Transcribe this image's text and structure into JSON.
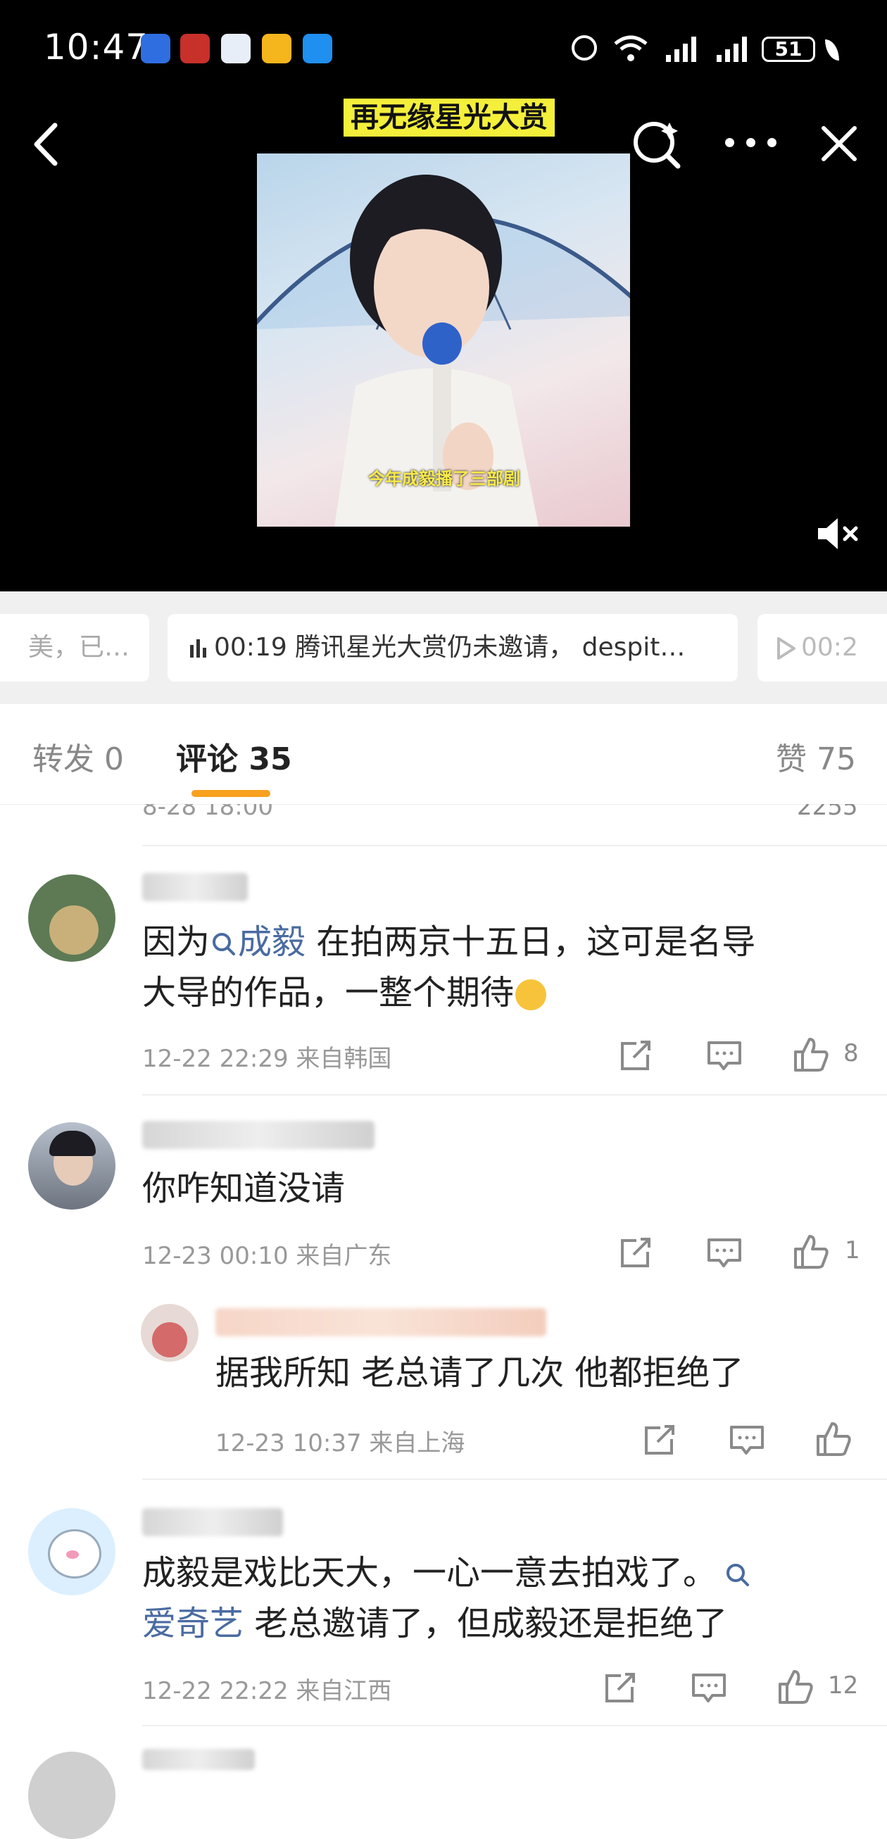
{
  "status_bar": {
    "time": "10:47",
    "battery": "51"
  },
  "video": {
    "title": "再无缘星光大赏",
    "subtitle": "今年成毅播了三部剧"
  },
  "audio_chips": {
    "left": "美，已…",
    "middle_time": "00:19",
    "middle_text": "腾讯星光大赏仍未邀请， despit…",
    "right": "00:2"
  },
  "tabs": {
    "repost_label": "转发",
    "repost_count": "0",
    "comments_label": "评论",
    "comments_count": "35",
    "likes_label": "赞",
    "likes_count": "75"
  },
  "top_partial": {
    "time": "8-28 18:00",
    "likes": "2255"
  },
  "comments": [
    {
      "pre": "因为",
      "keyword": "成毅",
      "text": "在拍两京十五日，这可是名导",
      "text2": "大导的作品，一整个期待",
      "time": "12-22 22:29",
      "location": "来自韩国",
      "likes": "8"
    },
    {
      "text": "你咋知道没请",
      "time": "12-23 00:10",
      "location": "来自广东",
      "likes": "1"
    },
    {
      "reply": true,
      "text": "据我所知 老总请了几次 他都拒绝了",
      "time": "12-23 10:37",
      "location": "来自上海",
      "likes": ""
    },
    {
      "text": "成毅是戏比天大，一心一意去拍戏了。",
      "keyword": "爱奇艺",
      "text2": "老总邀请了，但成毅还是拒绝了",
      "time": "12-22 22:22",
      "location": "来自江西",
      "likes": "12"
    }
  ]
}
